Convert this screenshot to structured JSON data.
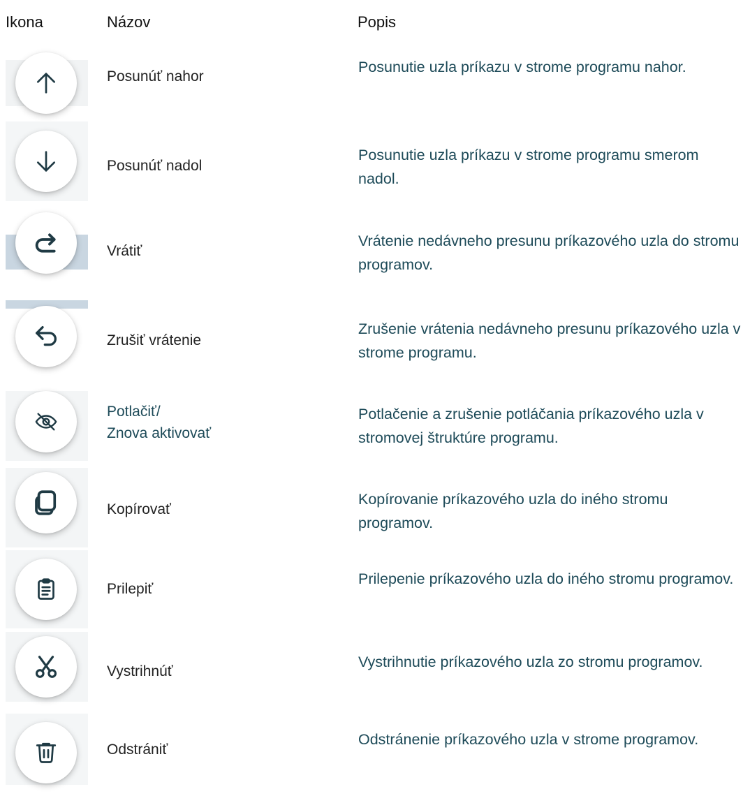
{
  "headers": {
    "icon": "Ikona",
    "name": "Názov",
    "description": "Popis"
  },
  "rows": [
    {
      "icon": "arrow-up-icon",
      "name": "Posunúť nahor",
      "description": "Posunutie uzla príkazu v strome programu nahor."
    },
    {
      "icon": "arrow-down-icon",
      "name": "Posunúť nadol",
      "description": "Posunutie uzla príkazu v strome programu smerom nadol."
    },
    {
      "icon": "redo-icon",
      "name": "Vrátiť",
      "description": "Vrátenie nedávneho presunu príkazového uzla do stromu programov."
    },
    {
      "icon": "undo-icon",
      "name": "Zrušiť vrátenie",
      "description": "Zrušenie vrátenia nedávneho presunu príkazového uzla v strome programu."
    },
    {
      "icon": "eye-off-icon",
      "name_line1": "Potlačiť/",
      "name_line2": "Znova aktivovať",
      "description": "Potlačenie a zrušenie potláčania príkazového uzla v stromovej štruktúre programu."
    },
    {
      "icon": "copy-icon",
      "name": "Kopírovať",
      "description": "Kopírovanie príkazového uzla do iného stromu programov."
    },
    {
      "icon": "clipboard-icon",
      "name": "Prilepiť",
      "description": "Prilepenie príkazového uzla do iného stromu programov."
    },
    {
      "icon": "scissors-icon",
      "name": "Vystrihnúť",
      "description": "Vystrihnutie príkazového uzla zo stromu programov."
    },
    {
      "icon": "trash-icon",
      "name": "Odstrániť",
      "description": "Odstránenie príkazového uzla v strome programov."
    }
  ],
  "colors": {
    "description_text": "#1d4a58",
    "name_text": "#222222",
    "icon_stroke": "#1f3a44",
    "highlight_bg": "#c9d6e1"
  }
}
